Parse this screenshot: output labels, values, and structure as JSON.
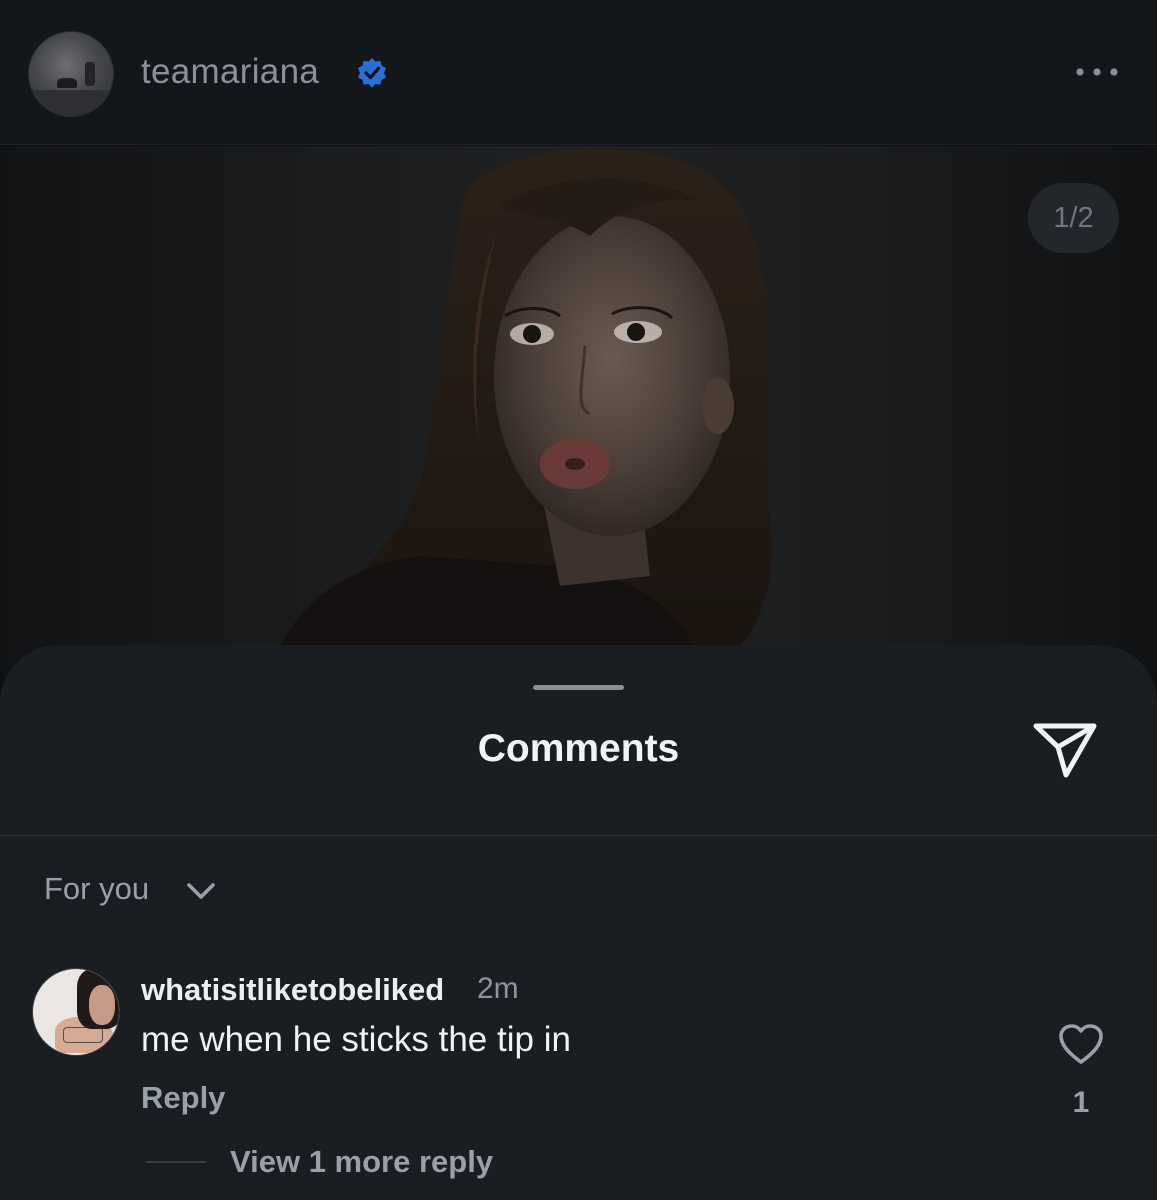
{
  "header": {
    "username": "teamariana",
    "verified": true,
    "verified_color": "#2a6fd6",
    "more_icon": "more-horizontal-icon"
  },
  "post": {
    "page_indicator": "1/2"
  },
  "comments_sheet": {
    "title": "Comments",
    "share_icon": "send-icon",
    "filter_label": "For you",
    "filter_icon": "chevron-down-icon",
    "comments": [
      {
        "username": "whatisitliketobeliked",
        "time": "2m",
        "text": "me when he sticks the tip in",
        "reply_label": "Reply",
        "like_count": "1",
        "like_icon": "heart-icon",
        "view_replies_label": "View 1 more reply"
      }
    ]
  }
}
